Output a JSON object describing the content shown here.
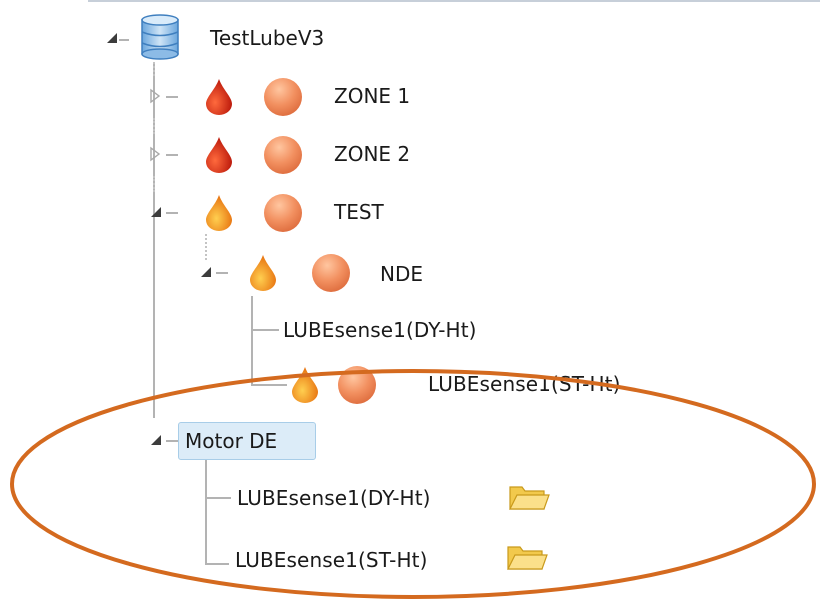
{
  "tree": {
    "root": {
      "label": "TestLubeV3",
      "icon": "database-icon",
      "expanded": true
    },
    "zone1": {
      "label": "ZONE 1",
      "icons": [
        "red-drop-icon",
        "orange-ball-icon"
      ],
      "expanded": false
    },
    "zone2": {
      "label": "ZONE 2",
      "icons": [
        "red-drop-icon",
        "orange-ball-icon"
      ],
      "expanded": false
    },
    "test": {
      "label": "TEST",
      "icons": [
        "orange-drop-icon",
        "orange-ball-icon"
      ],
      "expanded": true
    },
    "nde": {
      "label": "NDE",
      "icons": [
        "orange-drop-icon",
        "orange-ball-icon"
      ],
      "expanded": true
    },
    "nde_dy": {
      "label": "LUBEsense1(DY-Ht)"
    },
    "nde_st": {
      "label": "LUBEsense1(ST-Ht)",
      "icons": [
        "orange-drop-icon",
        "orange-ball-icon"
      ]
    },
    "motor_de": {
      "label": "Motor DE",
      "expanded": true,
      "selected": true
    },
    "motor_dy": {
      "label": "LUBEsense1(DY-Ht)",
      "icon": "folder-icon"
    },
    "motor_st": {
      "label": "LUBEsense1(ST-Ht)",
      "icon": "folder-icon"
    }
  },
  "colors": {
    "highlight_ellipse": "#d46a1f",
    "selection_fill": "#dcecf8",
    "selection_border": "#a8cde8",
    "drop_red": "#d42a14",
    "drop_orange": "#f08a10",
    "ball_orange": "#f0956a",
    "folder_yellow": "#f7d56a"
  }
}
